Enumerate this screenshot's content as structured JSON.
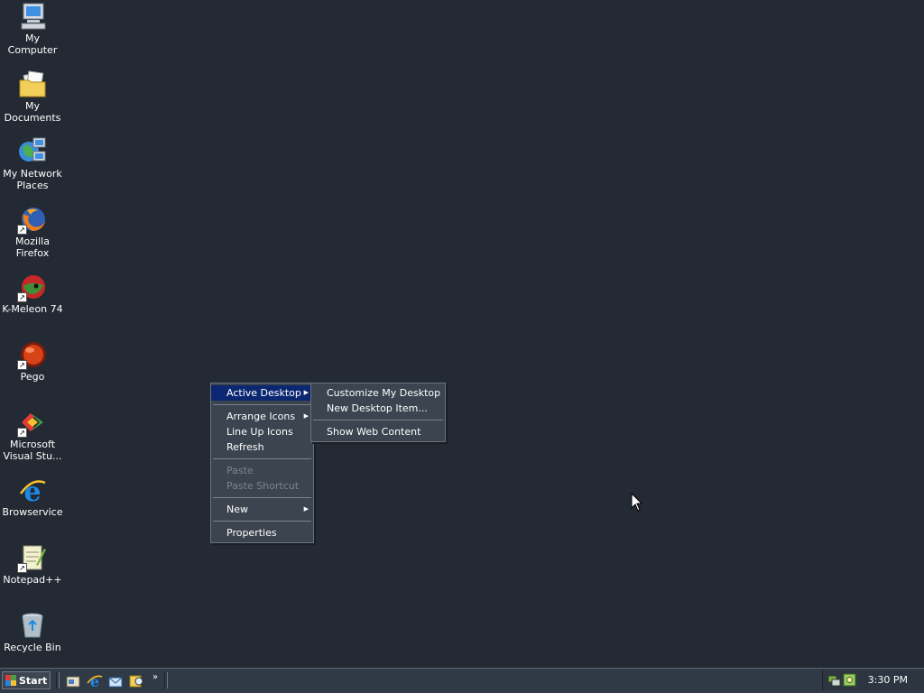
{
  "desktop_icons": [
    {
      "label": "My Computer",
      "icon": "my-computer-icon"
    },
    {
      "label": "My Documents",
      "icon": "my-documents-icon"
    },
    {
      "label": "My Network\nPlaces",
      "icon": "network-places-icon"
    },
    {
      "label": "Mozilla Firefox",
      "icon": "firefox-icon"
    },
    {
      "label": "K-Meleon 74",
      "icon": "kmeleon-icon"
    },
    {
      "label": "Pego",
      "icon": "pego-icon"
    },
    {
      "label": "Microsoft\nVisual Stu...",
      "icon": "visual-studio-icon"
    },
    {
      "label": "Browservice",
      "icon": "internet-explorer-icon"
    },
    {
      "label": "Notepad++",
      "icon": "notepadpp-icon"
    },
    {
      "label": "Recycle Bin",
      "icon": "recycle-bin-icon"
    }
  ],
  "context_menu": {
    "items": [
      {
        "label": "Active Desktop",
        "submenu": true
      },
      {
        "label": "Arrange Icons",
        "submenu": true
      },
      {
        "label": "Line Up Icons"
      },
      {
        "label": "Refresh"
      },
      {
        "label": "Paste",
        "disabled": true
      },
      {
        "label": "Paste Shortcut",
        "disabled": true
      },
      {
        "label": "New",
        "submenu": true
      },
      {
        "label": "Properties"
      }
    ],
    "arrow_glyph": "▶"
  },
  "submenu": {
    "items": [
      {
        "label": "Customize My Desktop"
      },
      {
        "label": "New Desktop Item..."
      },
      {
        "label": "Show Web Content"
      }
    ]
  },
  "taskbar": {
    "start_label": "Start",
    "chevron": "»",
    "clock": "3:30 PM"
  },
  "colors": {
    "desktop_bg": "#232a33",
    "menu_bg": "#3b444f",
    "menu_highlight": "#0c2772",
    "taskbar_bg": "#303946"
  }
}
